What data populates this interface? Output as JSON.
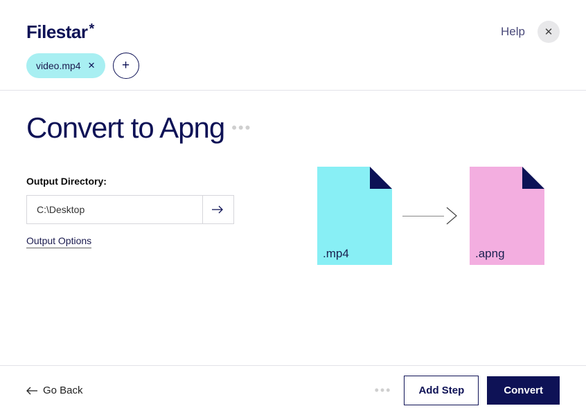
{
  "logo": {
    "text": "Filestar",
    "suffix": "*"
  },
  "header": {
    "help": "Help"
  },
  "files": [
    {
      "name": "video.mp4"
    }
  ],
  "page": {
    "title": "Convert to Apng"
  },
  "output": {
    "label": "Output Directory:",
    "value": "C:\\Desktop",
    "options": "Output Options"
  },
  "conversion": {
    "from_ext": ".mp4",
    "to_ext": ".apng"
  },
  "footer": {
    "back": "Go Back",
    "add_step": "Add Step",
    "convert": "Convert"
  }
}
